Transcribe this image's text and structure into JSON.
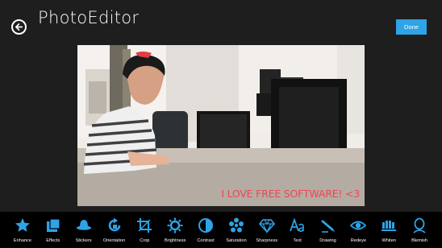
{
  "header": {
    "title": "PhotoEditor",
    "back_icon": "back-arrow-icon",
    "done_label": "Done",
    "accent_color": "#2ea3e6"
  },
  "photo": {
    "caption": "I LOVE FREE SOFTWARE! <3",
    "caption_color": "#f04455"
  },
  "toolbar": {
    "accent_color": "#2ea3e6",
    "tools": [
      {
        "label": "Enhance",
        "icon": "star-icon"
      },
      {
        "label": "Effects",
        "icon": "effects-icon"
      },
      {
        "label": "Stickers",
        "icon": "hat-icon"
      },
      {
        "label": "Orientation",
        "icon": "rotate-icon"
      },
      {
        "label": "Crop",
        "icon": "crop-icon"
      },
      {
        "label": "Brightness",
        "icon": "sun-icon"
      },
      {
        "label": "Contrast",
        "icon": "contrast-icon"
      },
      {
        "label": "Saturation",
        "icon": "saturation-icon"
      },
      {
        "label": "Sharpness",
        "icon": "diamond-icon"
      },
      {
        "label": "Text",
        "icon": "text-aa-icon"
      },
      {
        "label": "Drawing",
        "icon": "pen-icon"
      },
      {
        "label": "Redeye",
        "icon": "eye-icon"
      },
      {
        "label": "Whiten",
        "icon": "teeth-icon"
      },
      {
        "label": "Blemish",
        "icon": "face-icon"
      }
    ]
  }
}
